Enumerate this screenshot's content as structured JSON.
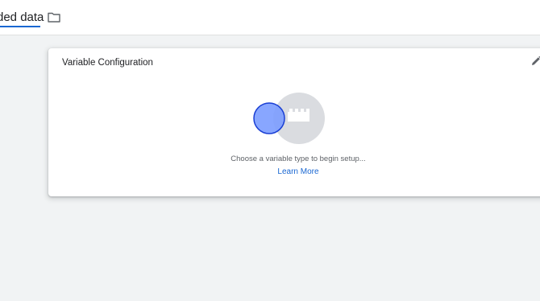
{
  "header": {
    "title": "ded data",
    "folder_icon": "folder-icon"
  },
  "card": {
    "title": "Variable Configuration",
    "edit_icon": "pencil-icon",
    "illustration_icon": "variable-type-illustration-icon",
    "hint": "Choose a variable type to begin setup...",
    "learn_more_label": "Learn More"
  },
  "colors": {
    "accent": "#1967d2",
    "background": "#f1f3f4",
    "circle_blue": "#7b9cff",
    "circle_grey": "#dadce0"
  }
}
